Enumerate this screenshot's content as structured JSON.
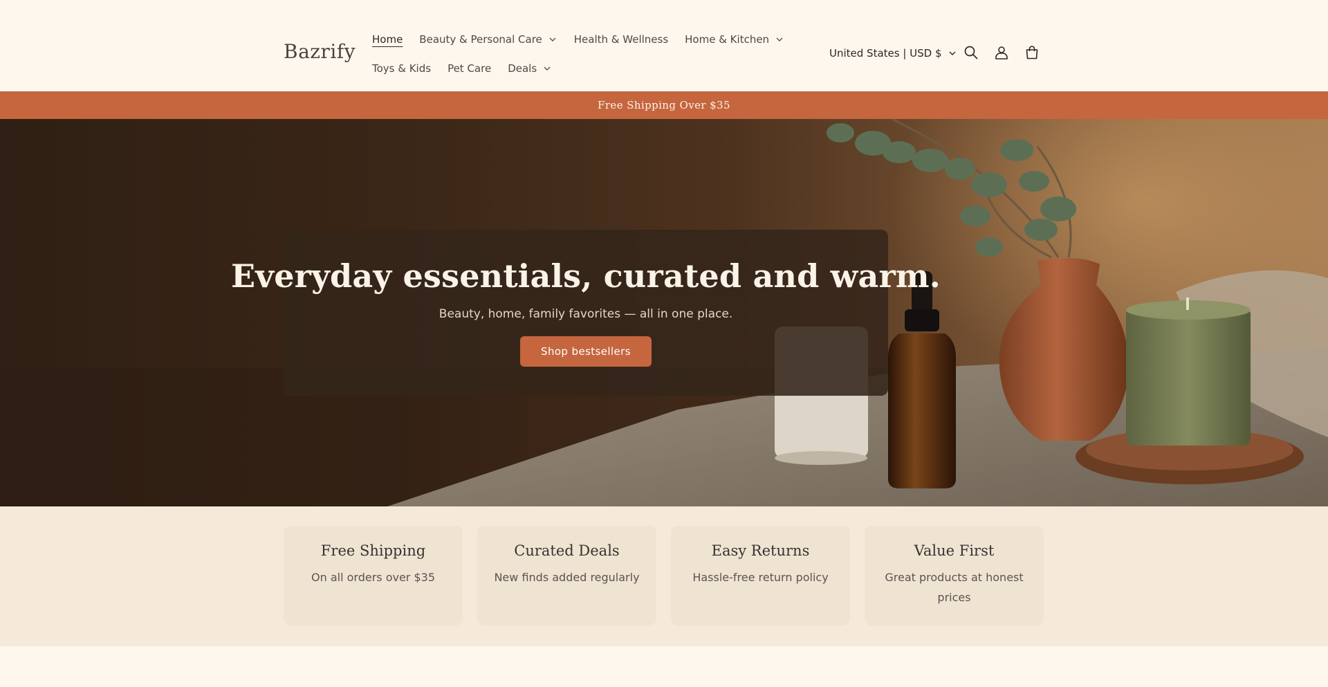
{
  "brand": {
    "logo": "Bazrify"
  },
  "nav": {
    "row1": [
      {
        "label": "Home",
        "active": true,
        "dropdown": false
      },
      {
        "label": "Beauty & Personal Care",
        "dropdown": true
      },
      {
        "label": "Health & Wellness",
        "dropdown": false
      },
      {
        "label": "Home & Kitchen",
        "dropdown": true
      }
    ],
    "row2": [
      {
        "label": "Toys & Kids",
        "dropdown": false
      },
      {
        "label": "Pet Care",
        "dropdown": false
      },
      {
        "label": "Deals",
        "dropdown": true
      }
    ]
  },
  "header_tools": {
    "region": "United States | USD $",
    "icons": [
      "search-icon",
      "account-icon",
      "cart-icon"
    ]
  },
  "announcement": "Free Shipping Over $35",
  "hero": {
    "title": "Everyday essentials, curated and warm.",
    "subtitle": "Beauty, home, family favorites — all in one place.",
    "cta": "Shop bestsellers"
  },
  "features": [
    {
      "title": "Free Shipping",
      "text": "On all orders over $35"
    },
    {
      "title": "Curated Deals",
      "text": "New finds added regularly"
    },
    {
      "title": "Easy Returns",
      "text": "Hassle-free return policy"
    },
    {
      "title": "Value First",
      "text": "Great products at honest prices"
    }
  ],
  "colors": {
    "background": "#fdf7ee",
    "accent": "#c5663e",
    "features_bg": "#f5ead9",
    "card_bg": "#efe3d2"
  }
}
